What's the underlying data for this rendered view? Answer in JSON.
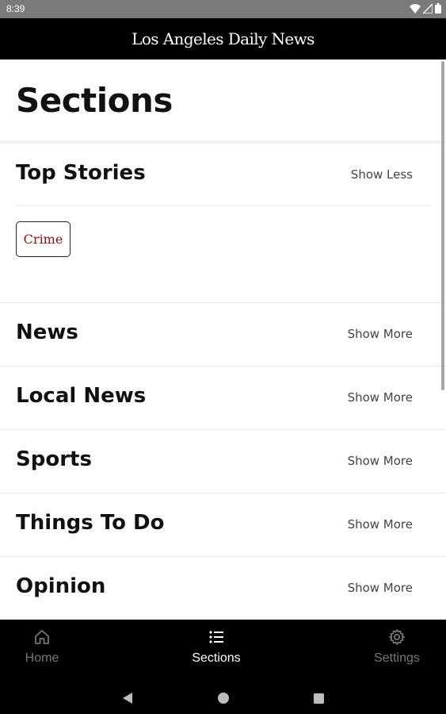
{
  "status_bar": {
    "time": "8:39"
  },
  "header": {
    "logo": "Los Angeles Daily News"
  },
  "page": {
    "title": "Sections"
  },
  "top_stories": {
    "title": "Top Stories",
    "action": "Show Less",
    "chips": [
      "Crime"
    ]
  },
  "sections": [
    {
      "title": "News",
      "action": "Show More"
    },
    {
      "title": "Local News",
      "action": "Show More"
    },
    {
      "title": "Sports",
      "action": "Show More"
    },
    {
      "title": "Things To Do",
      "action": "Show More"
    },
    {
      "title": "Opinion",
      "action": "Show More"
    }
  ],
  "bottom_nav": {
    "items": [
      {
        "label": "Home",
        "icon": "home-icon"
      },
      {
        "label": "Sections",
        "icon": "list-icon",
        "active": true
      },
      {
        "label": "Settings",
        "icon": "gear-icon"
      }
    ]
  },
  "colors": {
    "chip_text": "#8a1010",
    "header_bg": "#000000",
    "nav_inactive": "#777777"
  }
}
